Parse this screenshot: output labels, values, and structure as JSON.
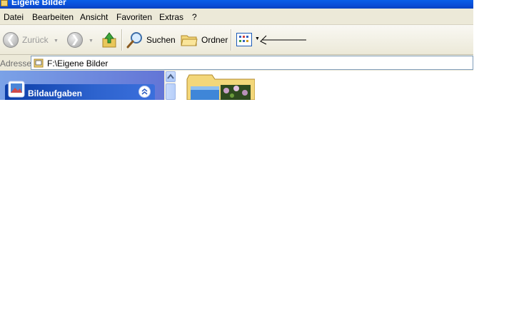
{
  "window": {
    "title": "Eigene Bilder"
  },
  "menu": {
    "items": [
      "Datei",
      "Bearbeiten",
      "Ansicht",
      "Favoriten",
      "Extras",
      "?"
    ]
  },
  "toolbar": {
    "back_label": "Zurück",
    "search_label": "Suchen",
    "folders_label": "Ordner"
  },
  "address": {
    "label": "Adresse",
    "value": "F:\\Eigene Bilder"
  },
  "task_pane": {
    "section_title": "Bildaufgaben"
  },
  "colors": {
    "titlebar": "#0a55e0",
    "chrome": "#ece9d8",
    "task_pane_bg": "#7ba2e7",
    "task_header": "#2d63ce"
  },
  "icons": [
    "back-icon",
    "forward-icon",
    "up-folder-icon",
    "search-icon",
    "folders-icon",
    "views-icon",
    "pictures-icon",
    "collapse-icon"
  ]
}
